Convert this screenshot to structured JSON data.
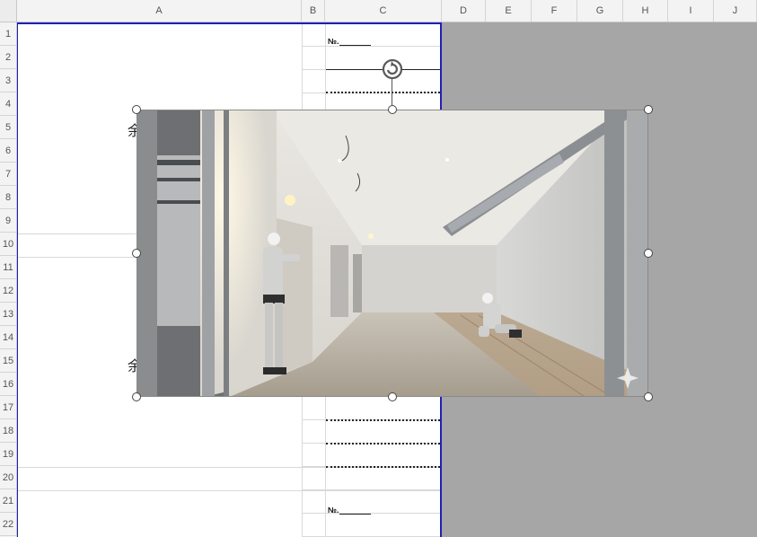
{
  "columns": [
    "A",
    "B",
    "C",
    "D",
    "E",
    "F",
    "G",
    "H",
    "I",
    "J"
  ],
  "rows": [
    "1",
    "2",
    "3",
    "4",
    "5",
    "6",
    "7",
    "8",
    "9",
    "10",
    "11",
    "12",
    "13",
    "14",
    "15",
    "16",
    "17",
    "18",
    "19",
    "20",
    "21",
    "22"
  ],
  "cells": {
    "c1_label": "№.",
    "c21_label": "№.",
    "a4_glyph": "余",
    "a15_glyph": "余"
  },
  "picture": {
    "subject": "construction-workers-interior-photo"
  },
  "colors": {
    "print_border": "#1f1fb8",
    "outside_area": "#a6a6a6"
  }
}
